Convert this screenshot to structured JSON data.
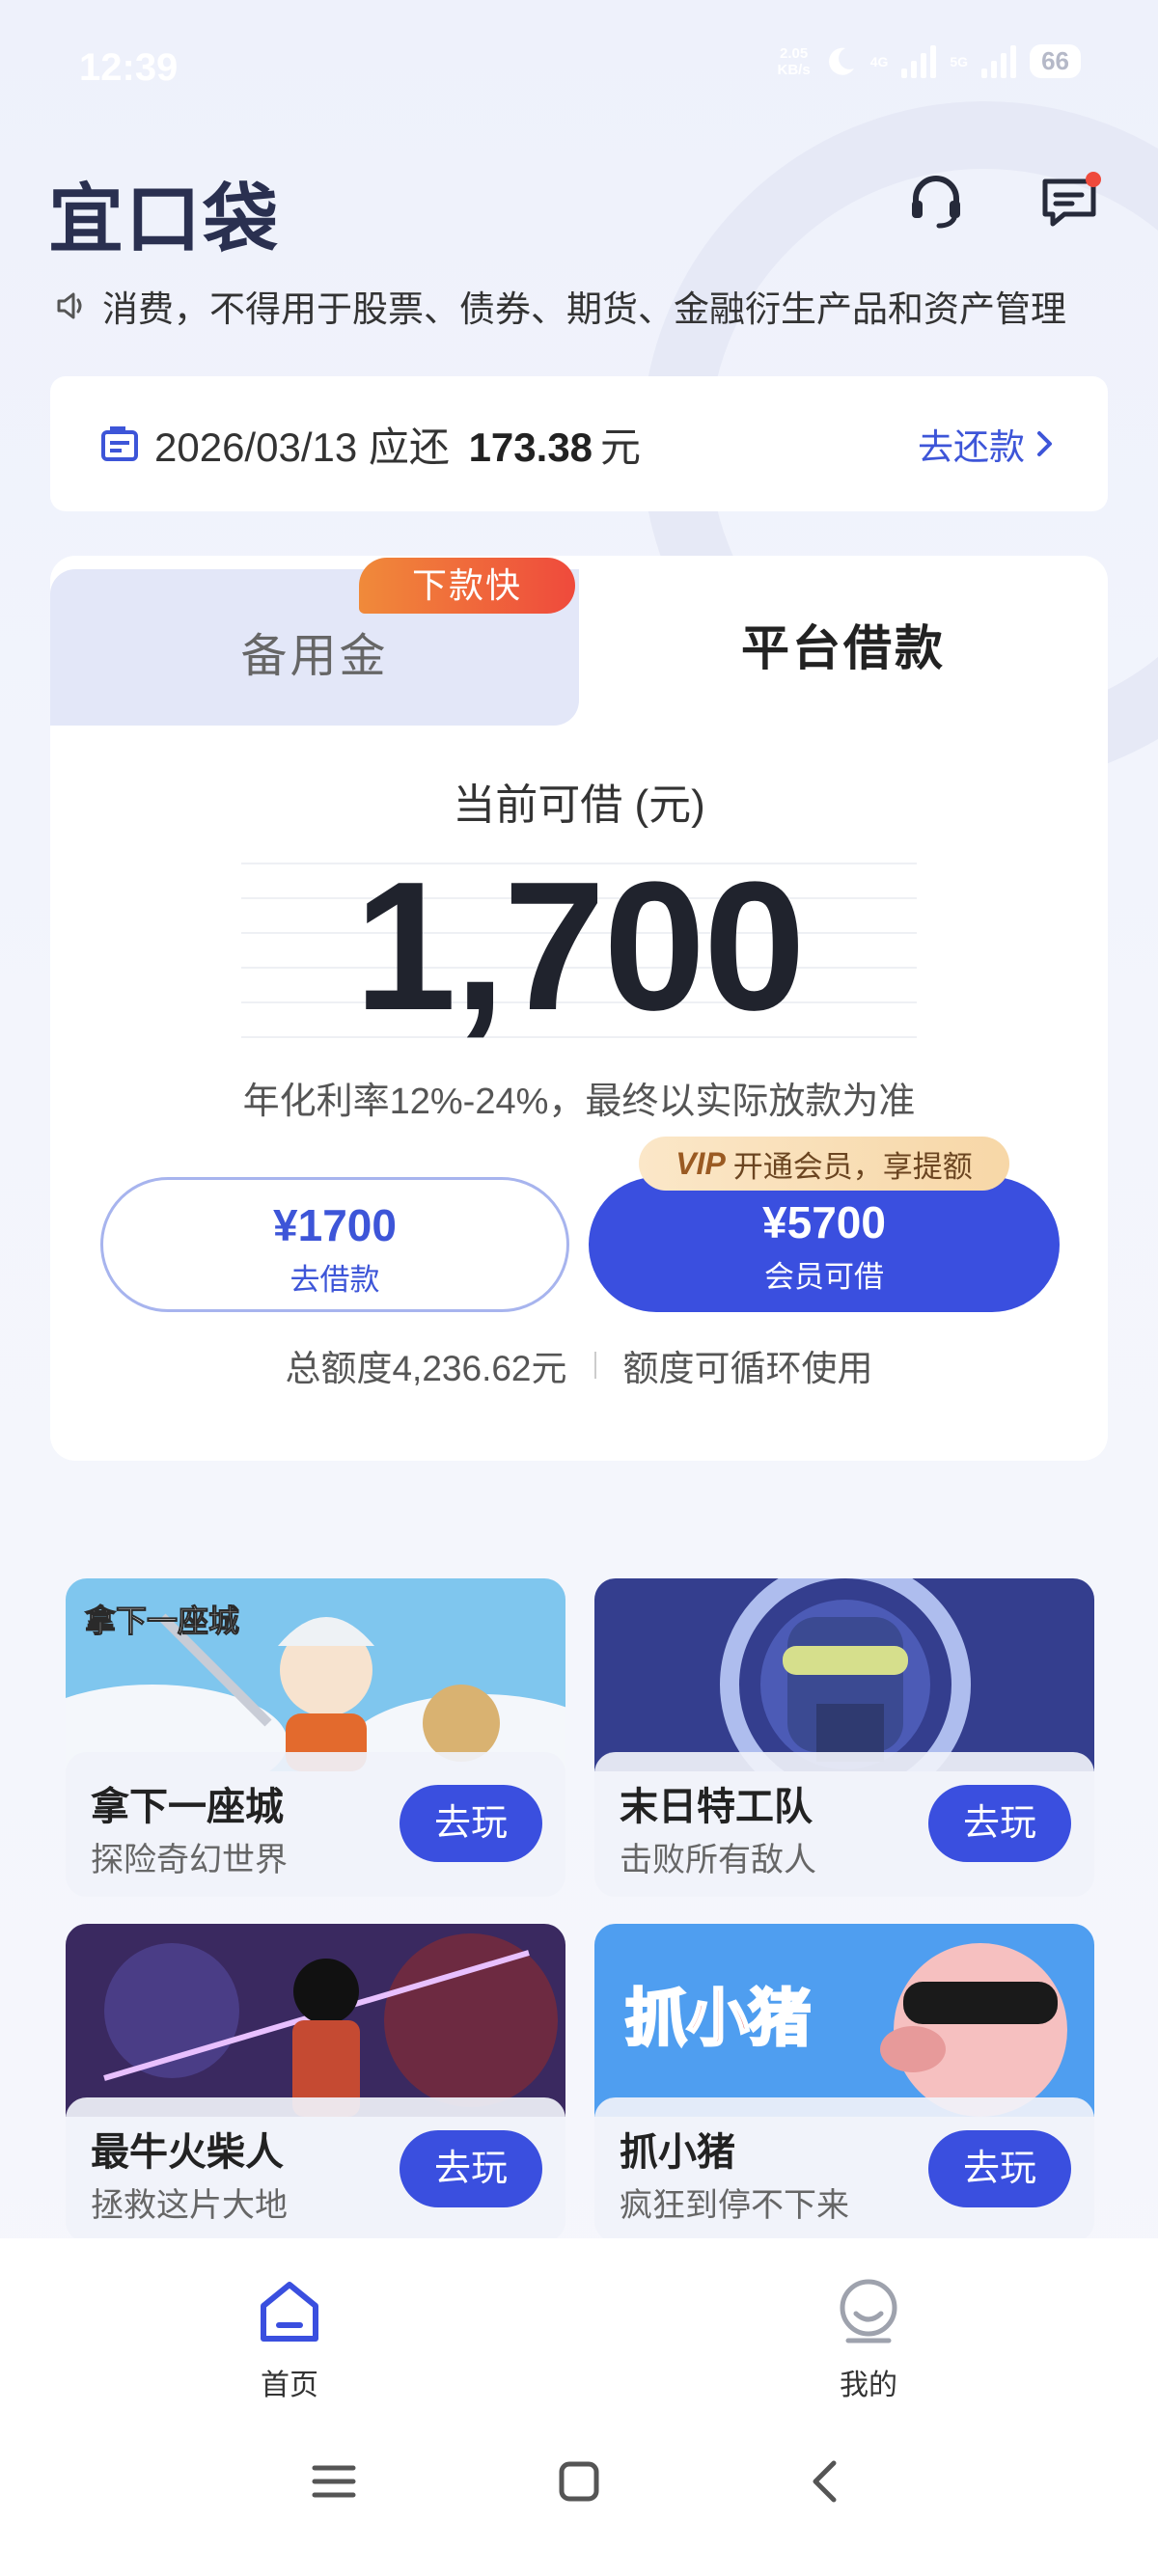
{
  "status_bar": {
    "time": "12:39",
    "net_speed_value": "2.05",
    "net_speed_unit": "KB/s",
    "sig1": "4G",
    "sig2": "5G",
    "battery": "66"
  },
  "header": {
    "logo": "宜口袋",
    "notice": "消费，不得用于股票、债券、期货、金融衍生产品和资产管理"
  },
  "repay": {
    "date": "2026/03/13",
    "due_label": "应还",
    "amount": "173.38",
    "unit": "元",
    "link": "去还款"
  },
  "loan": {
    "tab_left": "备用金",
    "tab_left_badge": "下款快",
    "tab_right": "平台借款",
    "available_label": "当前可借 (元)",
    "available_amount": "1,700",
    "rate_note": "年化利率12%-24%，最终以实际放款为准",
    "borrow_amount": "¥1700",
    "borrow_label": "去借款",
    "vip_tag_logo": "VIP",
    "vip_tag_text": "开通会员，享提额",
    "vip_amount": "¥5700",
    "vip_label": "会员可借",
    "total": "总额度4,236.62元",
    "recycle": "额度可循环使用"
  },
  "games": [
    {
      "title": "拿下一座城",
      "subtitle": "探险奇幻世界",
      "button": "去玩",
      "art_text": "拿下一座城"
    },
    {
      "title": "末日特工队",
      "subtitle": "击败所有敌人",
      "button": "去玩"
    },
    {
      "title": "最牛火柴人",
      "subtitle": "拯救这片大地",
      "button": "去玩"
    },
    {
      "title": "抓小猪",
      "subtitle": "疯狂到停不下来",
      "button": "去玩",
      "art_text": "抓小猪"
    }
  ],
  "bottom_nav": {
    "home": "首页",
    "mine": "我的"
  },
  "colors": {
    "primary": "#3a4fdf",
    "link": "#3d55d8",
    "badge_orange": "#ef5a3a"
  }
}
